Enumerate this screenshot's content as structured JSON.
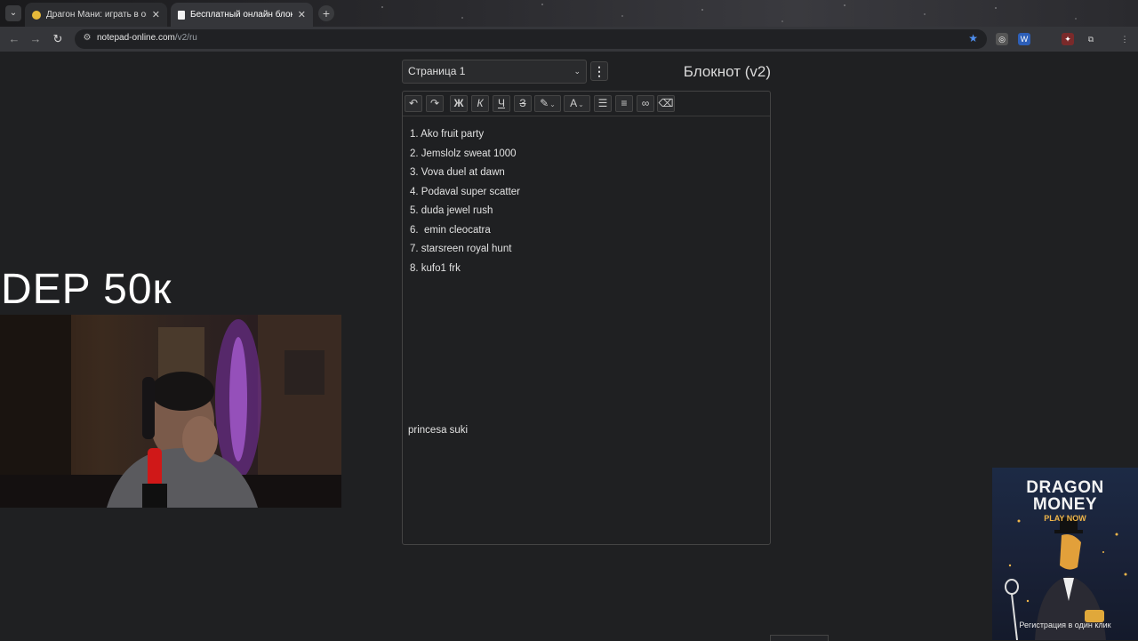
{
  "browser": {
    "tabs": [
      {
        "title": "Драгон Мани: играть в онлайн",
        "active": false
      },
      {
        "title": "Бесплатный онлайн блокнот д",
        "active": true
      }
    ],
    "url_host": "notepad-online.com",
    "url_path": "/v2/ru"
  },
  "notepad": {
    "page_selector": "Страница 1",
    "title": "Блокнот (v2)",
    "toolbar": {
      "bold": "Ж",
      "italic": "К",
      "underline": "Ч",
      "strike": "З",
      "font_color": "A"
    },
    "items": [
      "1. Ako fruit party",
      "2. Jemslolz sweat 1000",
      "3. Vova duel at dawn",
      "4. Podaval super scatter",
      "5. duda jewel rush",
      "6.  emin cleocatra",
      "7. starsreen royal hunt",
      "8. kufo1 frk"
    ],
    "extra_line": "princesa suki"
  },
  "overlay": {
    "dep_text": "DEP 50к"
  },
  "ad": {
    "line1": "DRAGON",
    "line2": "MONEY",
    "line3": "PLAY NOW",
    "registration": "Регистрация в один клик"
  },
  "colors": {
    "background": "#1f2022",
    "ad_accent": "#f0b64a",
    "bookmark_star": "#4f8ff0"
  }
}
